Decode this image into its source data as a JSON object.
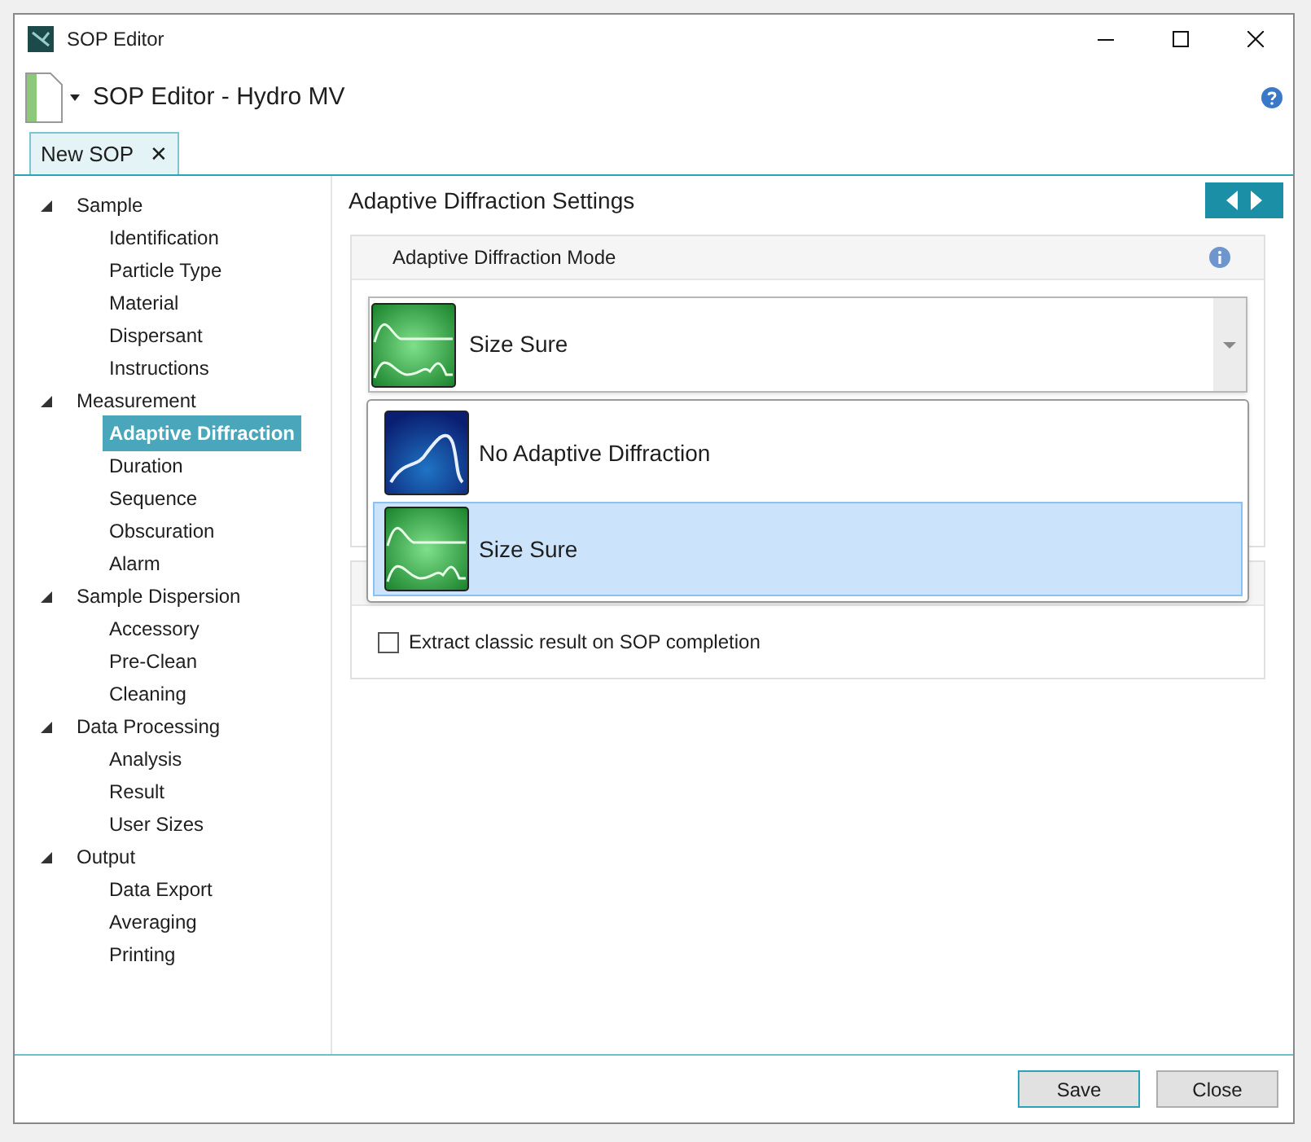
{
  "window": {
    "title": "SOP Editor"
  },
  "toolbar": {
    "title": "SOP Editor - Hydro MV"
  },
  "tabs": [
    {
      "label": "New SOP",
      "selected": true,
      "close": "✕"
    }
  ],
  "sidebar": {
    "items": [
      {
        "label": "Sample",
        "expanded": true,
        "children": [
          {
            "label": "Identification",
            "selected": false
          },
          {
            "label": "Particle Type",
            "selected": false
          },
          {
            "label": "Material",
            "selected": false
          },
          {
            "label": "Dispersant",
            "selected": false
          },
          {
            "label": "Instructions",
            "selected": false
          }
        ]
      },
      {
        "label": "Measurement",
        "expanded": true,
        "children": [
          {
            "label": "Adaptive Diffraction",
            "selected": true
          },
          {
            "label": "Duration",
            "selected": false
          },
          {
            "label": "Sequence",
            "selected": false
          },
          {
            "label": "Obscuration",
            "selected": false
          },
          {
            "label": "Alarm",
            "selected": false
          }
        ]
      },
      {
        "label": "Sample Dispersion",
        "expanded": true,
        "children": [
          {
            "label": "Accessory",
            "selected": false
          },
          {
            "label": "Pre-Clean",
            "selected": false
          },
          {
            "label": "Cleaning",
            "selected": false
          }
        ]
      },
      {
        "label": "Data Processing",
        "expanded": true,
        "children": [
          {
            "label": "Analysis",
            "selected": false
          },
          {
            "label": "Result",
            "selected": false
          },
          {
            "label": "User Sizes",
            "selected": false
          }
        ]
      },
      {
        "label": "Output",
        "expanded": true,
        "children": [
          {
            "label": "Data Export",
            "selected": false
          },
          {
            "label": "Averaging",
            "selected": false
          },
          {
            "label": "Printing",
            "selected": false
          }
        ]
      }
    ]
  },
  "content": {
    "title": "Adaptive Diffraction Settings",
    "mode_panel": {
      "title": "Adaptive Diffraction Mode",
      "dropdown": {
        "value": "Size Sure",
        "kind": "peaks",
        "expanded": true,
        "options": [
          {
            "label": "No Adaptive Diffraction",
            "kind": "wave",
            "selected": false
          },
          {
            "label": "Size Sure",
            "kind": "peaks",
            "selected": true
          }
        ]
      }
    },
    "checkbox": {
      "label": "Extract classic result on SOP completion",
      "checked": false
    }
  },
  "buttons": [
    {
      "label": "Save",
      "kind": "primary"
    },
    {
      "label": "Close",
      "kind": "normal"
    }
  ]
}
